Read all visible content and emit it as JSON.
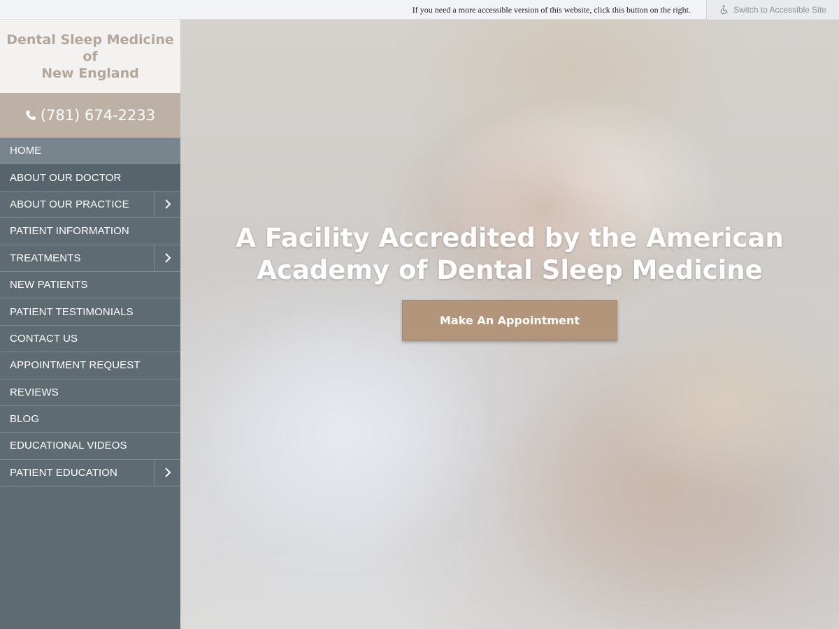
{
  "access_bar": {
    "text": "If you need a more accessible version of this website, click this button on the right.",
    "button_label": "Switch to Accessible Site",
    "button_icon": "wheelchair-icon"
  },
  "sidebar": {
    "logo_text_line1": "Dental Sleep Medicine of",
    "logo_text_line2": "New England",
    "phone": "(781) 674-2233",
    "phone_icon": "phone-icon",
    "nav": [
      {
        "label": "HOME",
        "has_submenu": false
      },
      {
        "label": "ABOUT OUR DOCTOR",
        "has_submenu": false
      },
      {
        "label": "ABOUT OUR PRACTICE",
        "has_submenu": true
      },
      {
        "label": "PATIENT INFORMATION",
        "has_submenu": false
      },
      {
        "label": "TREATMENTS",
        "has_submenu": true
      },
      {
        "label": "NEW PATIENTS",
        "has_submenu": false
      },
      {
        "label": "PATIENT TESTIMONIALS",
        "has_submenu": false
      },
      {
        "label": "CONTACT US",
        "has_submenu": false
      },
      {
        "label": "APPOINTMENT REQUEST",
        "has_submenu": false
      },
      {
        "label": "REVIEWS",
        "has_submenu": false
      },
      {
        "label": "BLOG",
        "has_submenu": false
      },
      {
        "label": "EDUCATIONAL VIDEOS",
        "has_submenu": false
      },
      {
        "label": "PATIENT EDUCATION",
        "has_submenu": true
      }
    ]
  },
  "hero": {
    "title_line1": "A Facility Accredited by the American",
    "title_line2": "Academy of Dental Sleep Medicine",
    "cta_label": "Make An Appointment"
  },
  "colors": {
    "sidebar": "#5f6b72",
    "active_nav": "#79858c",
    "phone_bar": "#bdb1a6",
    "logo_text": "#b3a699",
    "cta": "#b2957a"
  }
}
